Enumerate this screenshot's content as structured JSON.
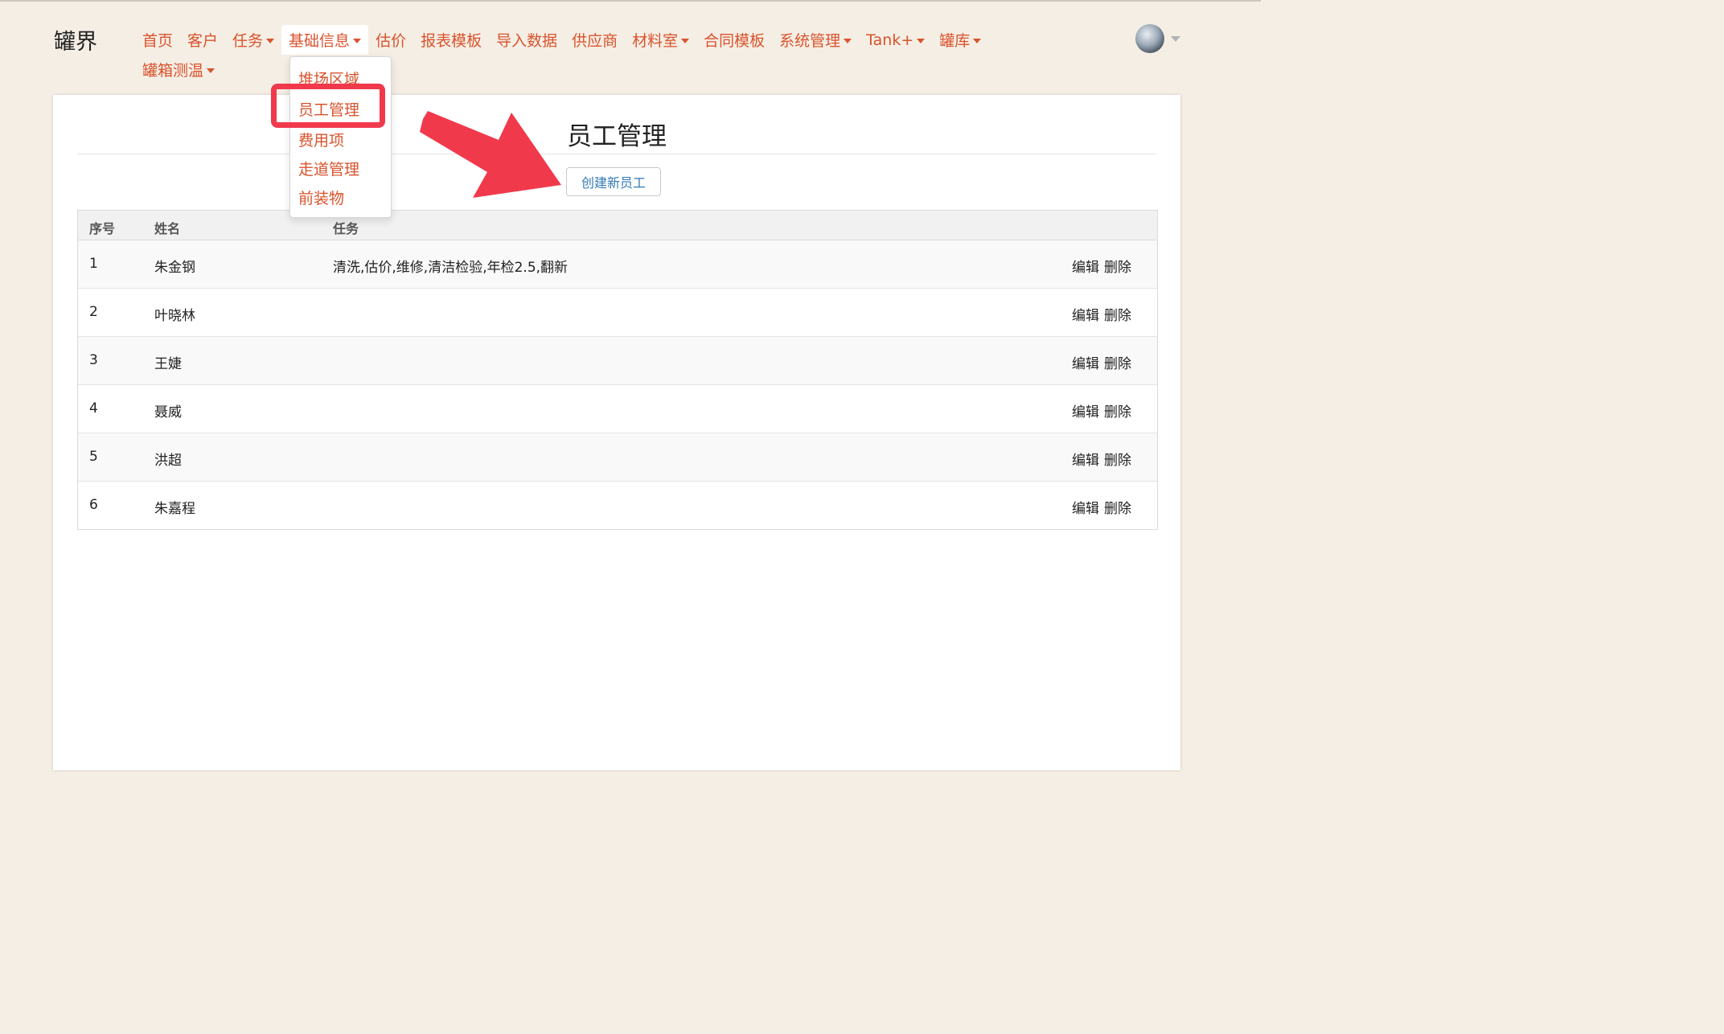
{
  "brand": "罐界",
  "nav": {
    "items": [
      {
        "label": "首页"
      },
      {
        "label": "客户"
      },
      {
        "label": "任务",
        "caret": true
      },
      {
        "label": "基础信息",
        "caret": true,
        "active": true
      },
      {
        "label": "估价"
      },
      {
        "label": "报表模板"
      },
      {
        "label": "导入数据"
      },
      {
        "label": "供应商"
      },
      {
        "label": "材料室",
        "caret": true
      },
      {
        "label": "合同模板"
      },
      {
        "label": "系统管理",
        "caret": true
      },
      {
        "label": "Tank+",
        "caret": true
      },
      {
        "label": "罐库",
        "caret": true
      }
    ],
    "second_row": {
      "label": "罐箱测温",
      "caret": true
    }
  },
  "dropdown": {
    "items": [
      "堆场区域",
      "员工管理",
      "费用项",
      "走道管理",
      "前装物"
    ],
    "highlighted": "员工管理"
  },
  "page": {
    "title": "员工管理",
    "create_button": "创建新员工"
  },
  "table": {
    "headers": [
      "序号",
      "姓名",
      "任务"
    ],
    "rows": [
      {
        "no": "1",
        "name": "朱金钢",
        "tasks": "清洗,估价,维修,清洁检验,年检2.5,翻新"
      },
      {
        "no": "2",
        "name": "叶晓林",
        "tasks": ""
      },
      {
        "no": "3",
        "name": "王婕",
        "tasks": ""
      },
      {
        "no": "4",
        "name": "聂威",
        "tasks": ""
      },
      {
        "no": "5",
        "name": "洪超",
        "tasks": ""
      },
      {
        "no": "6",
        "name": "朱嘉程",
        "tasks": ""
      }
    ],
    "actions": {
      "edit": "编辑",
      "delete": "删除"
    }
  },
  "colors": {
    "accent": "#d9532d",
    "background": "#f5eee4",
    "annotation": "#f1394c",
    "link_blue": "#337ab7"
  }
}
